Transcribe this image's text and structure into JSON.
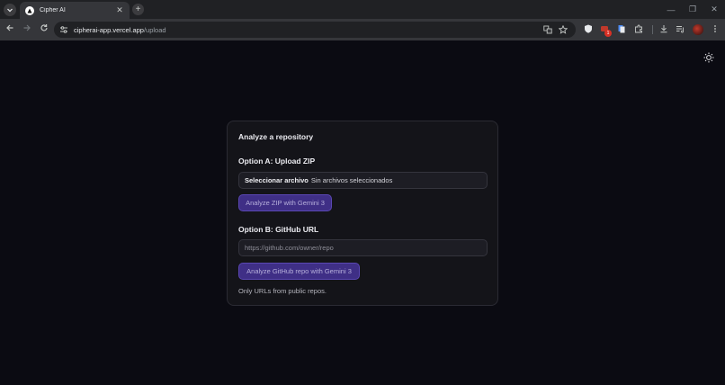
{
  "browser": {
    "tab_title": "Cipher AI",
    "tab_close": "✕",
    "new_tab": "+",
    "url_host": "cipherai-app.vercel.app",
    "url_path": "/upload",
    "window_controls": [
      "—",
      "❐",
      "✕"
    ],
    "notification_count": "1"
  },
  "page": {
    "card_title": "Analyze a repository",
    "option_a": {
      "title": "Option A: Upload ZIP",
      "file_button": "Seleccionar archivo",
      "file_status": "Sin archivos seleccionados",
      "submit_label": "Analyze ZIP with Gemini 3"
    },
    "option_b": {
      "title": "Option B: GitHub URL",
      "input_placeholder": "https://github.com/owner/repo",
      "input_value": "",
      "submit_label": "Analyze GitHub repo with Gemini 3",
      "note": "Only URLs from public repos."
    }
  },
  "colors": {
    "page_background": "#0b0b12",
    "card_background": "#141419",
    "accent_button": "#3f2f86",
    "accent_border": "#5a47b3"
  },
  "icons": [
    "tab-search-icon",
    "favicon-icon",
    "back-icon",
    "forward-icon",
    "reload-icon",
    "site-info-icon",
    "translate-icon",
    "star-icon",
    "shield-icon",
    "extension-icon",
    "puzzle-icon",
    "download-icon",
    "media-icon",
    "profile-avatar-icon",
    "menu-kebab-icon",
    "theme-toggle-icon"
  ]
}
